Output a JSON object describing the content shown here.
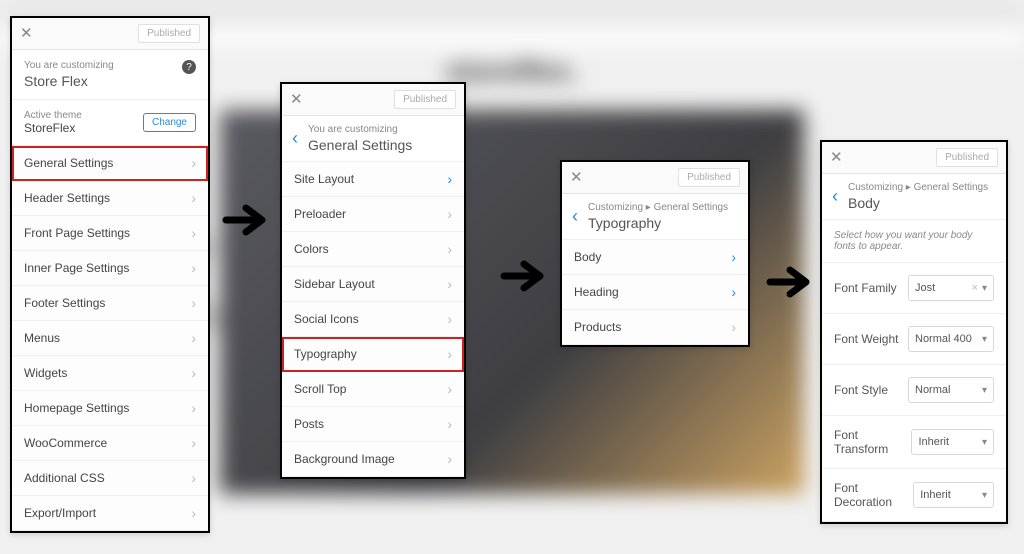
{
  "badge_published": "Published",
  "p1": {
    "customizing_label": "You are customizing",
    "site": "Store Flex",
    "active_theme_label": "Active theme",
    "theme": "StoreFlex",
    "change": "Change",
    "items": [
      "General Settings",
      "Header Settings",
      "Front Page Settings",
      "Inner Page Settings",
      "Footer Settings",
      "Menus",
      "Widgets",
      "Homepage Settings",
      "WooCommerce",
      "Additional CSS",
      "Export/Import"
    ]
  },
  "p2": {
    "customizing_label": "You are customizing",
    "title": "General Settings",
    "items": [
      "Site Layout",
      "Preloader",
      "Colors",
      "Sidebar Layout",
      "Social Icons",
      "Typography",
      "Scroll Top",
      "Posts",
      "Background Image"
    ]
  },
  "p3": {
    "crumb": "Customizing  ▸  General Settings",
    "title": "Typography",
    "items": [
      "Body",
      "Heading",
      "Products"
    ]
  },
  "p4": {
    "crumb": "Customizing  ▸  General Settings",
    "title": "Body",
    "note": "Select how you want your body fonts to appear.",
    "fields": [
      {
        "label": "Font Family",
        "value": "Jost",
        "xclear": true
      },
      {
        "label": "Font Weight",
        "value": "Normal 400"
      },
      {
        "label": "Font Style",
        "value": "Normal"
      },
      {
        "label": "Font Transform",
        "value": "Inherit"
      },
      {
        "label": "Font Decoration",
        "value": "Inherit"
      }
    ]
  }
}
